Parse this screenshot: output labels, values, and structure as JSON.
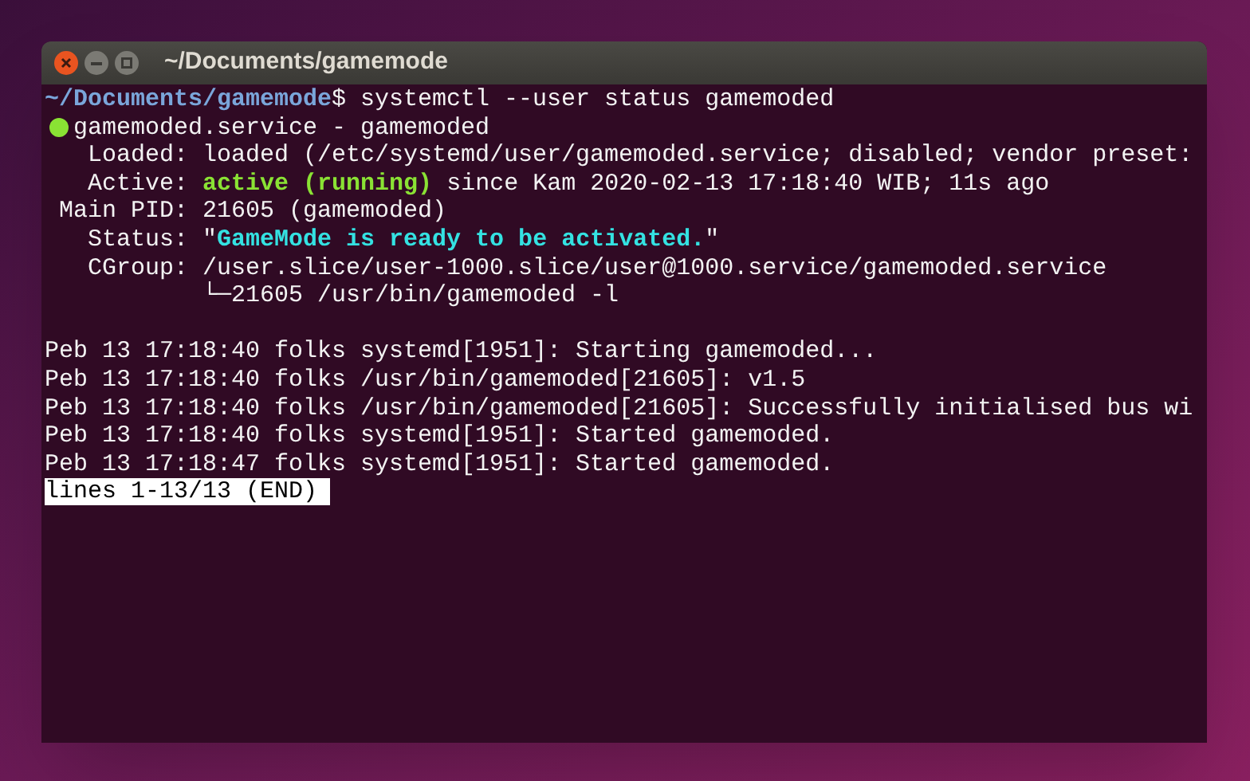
{
  "window": {
    "title": "~/Documents/gamemode"
  },
  "terminal": {
    "lines": [
      {
        "kind": "text",
        "segments": [
          {
            "kind": "prompt",
            "text": "~/Documents/gamemode"
          },
          {
            "kind": "plain",
            "text": "$ systemctl --user status gamemoded"
          }
        ]
      },
      {
        "kind": "unit",
        "segments": [
          {
            "kind": "plain",
            "text": "gamemoded.service - gamemoded"
          }
        ]
      },
      {
        "kind": "text",
        "segments": [
          {
            "kind": "plain",
            "text": "   Loaded: loaded (/etc/systemd/user/gamemoded.service; disabled; vendor preset:"
          }
        ]
      },
      {
        "kind": "text",
        "segments": [
          {
            "kind": "plain",
            "text": "   Active: "
          },
          {
            "kind": "active",
            "text": "active (running)"
          },
          {
            "kind": "plain",
            "text": " since Kam 2020-02-13 17:18:40 WIB; 11s ago"
          }
        ]
      },
      {
        "kind": "text",
        "segments": [
          {
            "kind": "plain",
            "text": " Main PID: 21605 (gamemoded)"
          }
        ]
      },
      {
        "kind": "text",
        "segments": [
          {
            "kind": "plain",
            "text": "   Status: \""
          },
          {
            "kind": "highlight",
            "text": "GameMode is ready to be activated."
          },
          {
            "kind": "plain",
            "text": "\""
          }
        ]
      },
      {
        "kind": "text",
        "segments": [
          {
            "kind": "plain",
            "text": "   CGroup: /user.slice/user-1000.slice/user@1000.service/gamemoded.service"
          }
        ]
      },
      {
        "kind": "text",
        "segments": [
          {
            "kind": "plain",
            "text": "           └─21605 /usr/bin/gamemoded -l"
          }
        ]
      },
      {
        "kind": "blank"
      },
      {
        "kind": "text",
        "segments": [
          {
            "kind": "plain",
            "text": "Peb 13 17:18:40 folks systemd[1951]: Starting gamemoded..."
          }
        ]
      },
      {
        "kind": "text",
        "segments": [
          {
            "kind": "plain",
            "text": "Peb 13 17:18:40 folks /usr/bin/gamemoded[21605]: v1.5"
          }
        ]
      },
      {
        "kind": "text",
        "segments": [
          {
            "kind": "plain",
            "text": "Peb 13 17:18:40 folks /usr/bin/gamemoded[21605]: Successfully initialised bus wi"
          }
        ]
      },
      {
        "kind": "text",
        "segments": [
          {
            "kind": "plain",
            "text": "Peb 13 17:18:40 folks systemd[1951]: Started gamemoded."
          }
        ]
      },
      {
        "kind": "text",
        "segments": [
          {
            "kind": "plain",
            "text": "Peb 13 17:18:47 folks systemd[1951]: Started gamemoded."
          }
        ]
      }
    ],
    "pager_status": "lines 1-13/13 (END)"
  }
}
